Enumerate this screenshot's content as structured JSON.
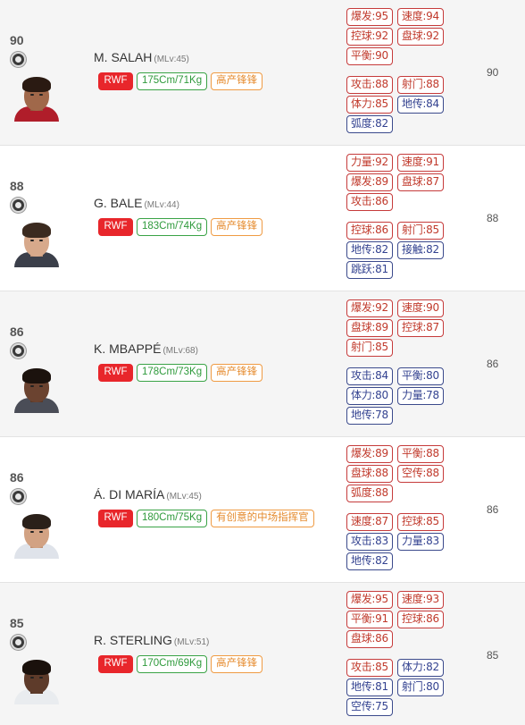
{
  "players": [
    {
      "rating": "90",
      "name": "M. SALAH",
      "mlv": "(MLv:45)",
      "position": "RWF",
      "body": "175Cm/71Kg",
      "style": "高产锋锋",
      "colors": {
        "skin": "#a0684a",
        "hair": "#2a1a12",
        "shirt": "#b01d2a",
        "neck": "#8e5a3e"
      },
      "stats_group1": [
        [
          {
            "label": "爆发:95",
            "color": "red"
          },
          {
            "label": "速度:94",
            "color": "red"
          }
        ],
        [
          {
            "label": "控球:92",
            "color": "red"
          },
          {
            "label": "盘球:92",
            "color": "red"
          }
        ],
        [
          {
            "label": "平衡:90",
            "color": "red"
          }
        ]
      ],
      "stats_group2": [
        [
          {
            "label": "攻击:88",
            "color": "red"
          },
          {
            "label": "射门:88",
            "color": "red"
          }
        ],
        [
          {
            "label": "体力:85",
            "color": "red"
          },
          {
            "label": "地传:84",
            "color": "blue"
          }
        ],
        [
          {
            "label": "弧度:82",
            "color": "blue"
          }
        ]
      ],
      "overall": "90"
    },
    {
      "rating": "88",
      "name": "G. BALE",
      "mlv": "(MLv:44)",
      "position": "RWF",
      "body": "183Cm/74Kg",
      "style": "高产锋锋",
      "colors": {
        "skin": "#d7a98b",
        "hair": "#3b2a1f",
        "shirt": "#3b3f4a",
        "neck": "#c39477"
      },
      "stats_group1": [
        [
          {
            "label": "力量:92",
            "color": "red"
          },
          {
            "label": "速度:91",
            "color": "red"
          }
        ],
        [
          {
            "label": "爆发:89",
            "color": "red"
          },
          {
            "label": "盘球:87",
            "color": "red"
          }
        ],
        [
          {
            "label": "攻击:86",
            "color": "red"
          }
        ]
      ],
      "stats_group2": [
        [
          {
            "label": "控球:86",
            "color": "red"
          },
          {
            "label": "射门:85",
            "color": "red"
          }
        ],
        [
          {
            "label": "地传:82",
            "color": "blue"
          },
          {
            "label": "接触:82",
            "color": "blue"
          }
        ],
        [
          {
            "label": "跳跃:81",
            "color": "blue"
          }
        ]
      ],
      "overall": "88"
    },
    {
      "rating": "86",
      "name": "K. MBAPPÉ",
      "mlv": "(MLv:68)",
      "position": "RWF",
      "body": "178Cm/73Kg",
      "style": "高产锋锋",
      "colors": {
        "skin": "#6b4330",
        "hair": "#1b120d",
        "shirt": "#4a4d57",
        "neck": "#5a3827"
      },
      "stats_group1": [
        [
          {
            "label": "爆发:92",
            "color": "red"
          },
          {
            "label": "速度:90",
            "color": "red"
          }
        ],
        [
          {
            "label": "盘球:89",
            "color": "red"
          },
          {
            "label": "控球:87",
            "color": "red"
          }
        ],
        [
          {
            "label": "射门:85",
            "color": "red"
          }
        ]
      ],
      "stats_group2": [
        [
          {
            "label": "攻击:84",
            "color": "blue"
          },
          {
            "label": "平衡:80",
            "color": "blue"
          }
        ],
        [
          {
            "label": "体力:80",
            "color": "blue"
          },
          {
            "label": "力量:78",
            "color": "blue"
          }
        ],
        [
          {
            "label": "地传:78",
            "color": "blue"
          }
        ]
      ],
      "overall": "86"
    },
    {
      "rating": "86",
      "name": "Á. DI MARÍA",
      "mlv": "(MLv:45)",
      "position": "RWF",
      "body": "180Cm/75Kg",
      "style": "有创意的中场指挥官",
      "colors": {
        "skin": "#d2a283",
        "hair": "#2a2019",
        "shirt": "#dfe3ea",
        "neck": "#bf8f70"
      },
      "stats_group1": [
        [
          {
            "label": "爆发:89",
            "color": "red"
          },
          {
            "label": "平衡:88",
            "color": "red"
          }
        ],
        [
          {
            "label": "盘球:88",
            "color": "red"
          },
          {
            "label": "空传:88",
            "color": "red"
          }
        ],
        [
          {
            "label": "弧度:88",
            "color": "red"
          }
        ]
      ],
      "stats_group2": [
        [
          {
            "label": "速度:87",
            "color": "red"
          },
          {
            "label": "控球:85",
            "color": "red"
          }
        ],
        [
          {
            "label": "攻击:83",
            "color": "blue"
          },
          {
            "label": "力量:83",
            "color": "blue"
          }
        ],
        [
          {
            "label": "地传:82",
            "color": "blue"
          }
        ]
      ],
      "overall": "86"
    },
    {
      "rating": "85",
      "name": "R. STERLING",
      "mlv": "(MLv:51)",
      "position": "RWF",
      "body": "170Cm/69Kg",
      "style": "高产锋锋",
      "colors": {
        "skin": "#5e3b2a",
        "hair": "#1a110c",
        "shirt": "#e9ecef",
        "neck": "#4f3122"
      },
      "stats_group1": [
        [
          {
            "label": "爆发:95",
            "color": "red"
          },
          {
            "label": "速度:93",
            "color": "red"
          }
        ],
        [
          {
            "label": "平衡:91",
            "color": "red"
          },
          {
            "label": "控球:86",
            "color": "red"
          }
        ],
        [
          {
            "label": "盘球:86",
            "color": "red"
          }
        ]
      ],
      "stats_group2": [
        [
          {
            "label": "攻击:85",
            "color": "red"
          },
          {
            "label": "体力:82",
            "color": "blue"
          }
        ],
        [
          {
            "label": "地传:81",
            "color": "blue"
          },
          {
            "label": "射门:80",
            "color": "blue"
          }
        ],
        [
          {
            "label": "空传:75",
            "color": "blue"
          }
        ]
      ],
      "overall": "85"
    }
  ]
}
